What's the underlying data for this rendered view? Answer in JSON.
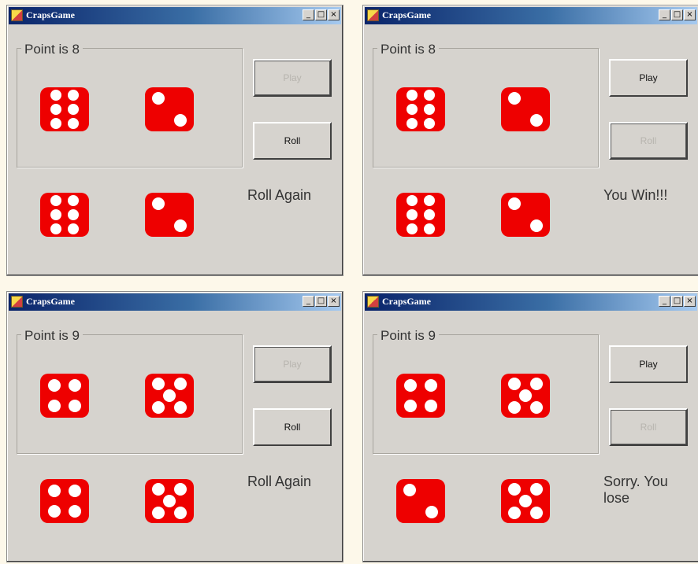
{
  "windows": [
    {
      "title": "CrapsGame",
      "point_label": "Point is 8",
      "play_label": "Play",
      "play_enabled": false,
      "roll_label": "Roll",
      "roll_enabled": true,
      "status": "Roll Again",
      "point_dice": [
        6,
        2
      ],
      "roll_dice": [
        6,
        2
      ]
    },
    {
      "title": "CrapsGame",
      "point_label": "Point is 8",
      "play_label": "Play",
      "play_enabled": true,
      "roll_label": "Roll",
      "roll_enabled": false,
      "status": "You Win!!!",
      "point_dice": [
        6,
        2
      ],
      "roll_dice": [
        6,
        2
      ]
    },
    {
      "title": "CrapsGame",
      "point_label": "Point is 9",
      "play_label": "Play",
      "play_enabled": false,
      "roll_label": "Roll",
      "roll_enabled": true,
      "status": "Roll Again",
      "point_dice": [
        4,
        5
      ],
      "roll_dice": [
        4,
        5
      ]
    },
    {
      "title": "CrapsGame",
      "point_label": "Point is 9",
      "play_label": "Play",
      "play_enabled": true,
      "roll_label": "Roll",
      "roll_enabled": false,
      "status": "Sorry. You lose",
      "point_dice": [
        4,
        5
      ],
      "roll_dice": [
        2,
        5
      ]
    }
  ],
  "window_controls": [
    "_",
    "□",
    "×"
  ],
  "colors": {
    "die": "#ee0000",
    "pip": "#ffffff",
    "title_start": "#0a246a",
    "title_end": "#a6caf0"
  }
}
